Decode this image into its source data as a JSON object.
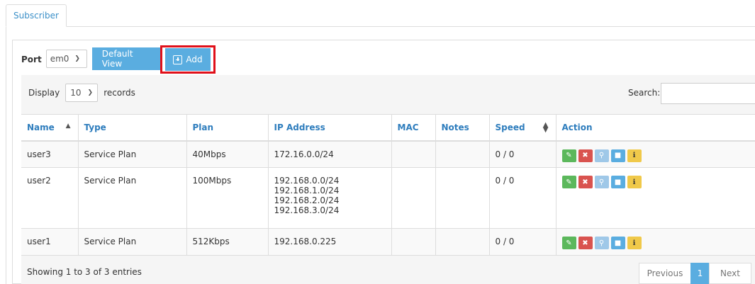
{
  "tabs": {
    "active": "Subscriber"
  },
  "toolbar": {
    "port_label": "Port",
    "port_value": "em0",
    "default_view_label": "Default View",
    "add_label": "Add"
  },
  "list_controls": {
    "display_prefix": "Display",
    "display_value": "10",
    "display_suffix": "records",
    "search_label": "Search:",
    "search_value": ""
  },
  "table": {
    "headers": {
      "name": "Name",
      "type": "Type",
      "plan": "Plan",
      "ip": "IP Address",
      "mac": "MAC",
      "notes": "Notes",
      "speed": "Speed",
      "action": "Action"
    },
    "rows": [
      {
        "name": "user3",
        "type": "Service Plan",
        "plan": "40Mbps",
        "ip": [
          "172.16.0.0/24"
        ],
        "mac": "",
        "notes": "",
        "speed": "0 / 0"
      },
      {
        "name": "user2",
        "type": "Service Plan",
        "plan": "100Mbps",
        "ip": [
          "192.168.0.0/24",
          "192.168.1.0/24",
          "192.168.2.0/24",
          "192.168.3.0/24"
        ],
        "mac": "",
        "notes": "",
        "speed": "0 / 0"
      },
      {
        "name": "user1",
        "type": "Service Plan",
        "plan": "512Kbps",
        "ip": [
          "192.168.0.225"
        ],
        "mac": "",
        "notes": "",
        "speed": "0 / 0"
      }
    ]
  },
  "footer": {
    "info": "Showing 1 to 3 of 3 entries",
    "prev": "Previous",
    "page": "1",
    "next": "Next"
  },
  "colors": {
    "accent": "#5aade0",
    "highlight_box": "#e0101a",
    "header_text": "#2e7dbd"
  }
}
